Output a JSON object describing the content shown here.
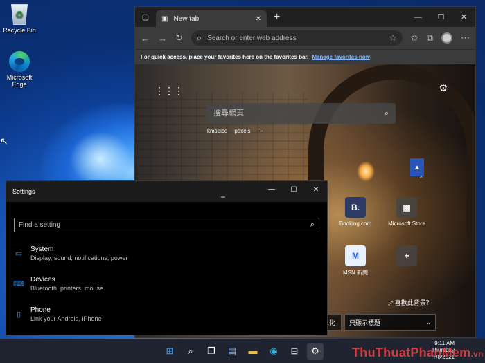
{
  "desktop": {
    "icons": [
      {
        "label": "Recycle Bin",
        "icon": "recycle-bin-icon"
      },
      {
        "label": "Microsoft Edge",
        "icon": "edge-icon"
      }
    ]
  },
  "edge": {
    "tab_title": "New tab",
    "address_placeholder": "Search or enter web address",
    "favbar_text": "For quick access, place your favorites here on the favorites bar.",
    "favbar_link": "Manage favorites now",
    "ntp": {
      "search_placeholder": "搜尋網頁",
      "quicklinks": [
        "kmspico",
        "pexels",
        "⋯"
      ],
      "tiles": [
        {
          "label": "Booking.com",
          "glyph": "B."
        },
        {
          "label": "Microsoft Store",
          "glyph": "▦"
        },
        {
          "label": "MSN 新聞",
          "glyph": "M"
        },
        {
          "label": "",
          "glyph": "+"
        }
      ],
      "like_picture": "喜歡此背景？",
      "bottom_left": "人化",
      "bottom_dropdown": "只顯示標題"
    }
  },
  "settings": {
    "title": "Settings",
    "search_placeholder": "Find a setting",
    "items": [
      {
        "title": "System",
        "desc": "Display, sound, notifications, power"
      },
      {
        "title": "Devices",
        "desc": "Bluetooth, printers, mouse"
      },
      {
        "title": "Phone",
        "desc": "Link your Android, iPhone"
      }
    ]
  },
  "taskbar": {
    "time": "9:11 AM",
    "date": "7/8/2021",
    "day": "Thursday"
  },
  "watermark": {
    "text": "ThuThuatPhanMem",
    "suffix": ".vn"
  }
}
